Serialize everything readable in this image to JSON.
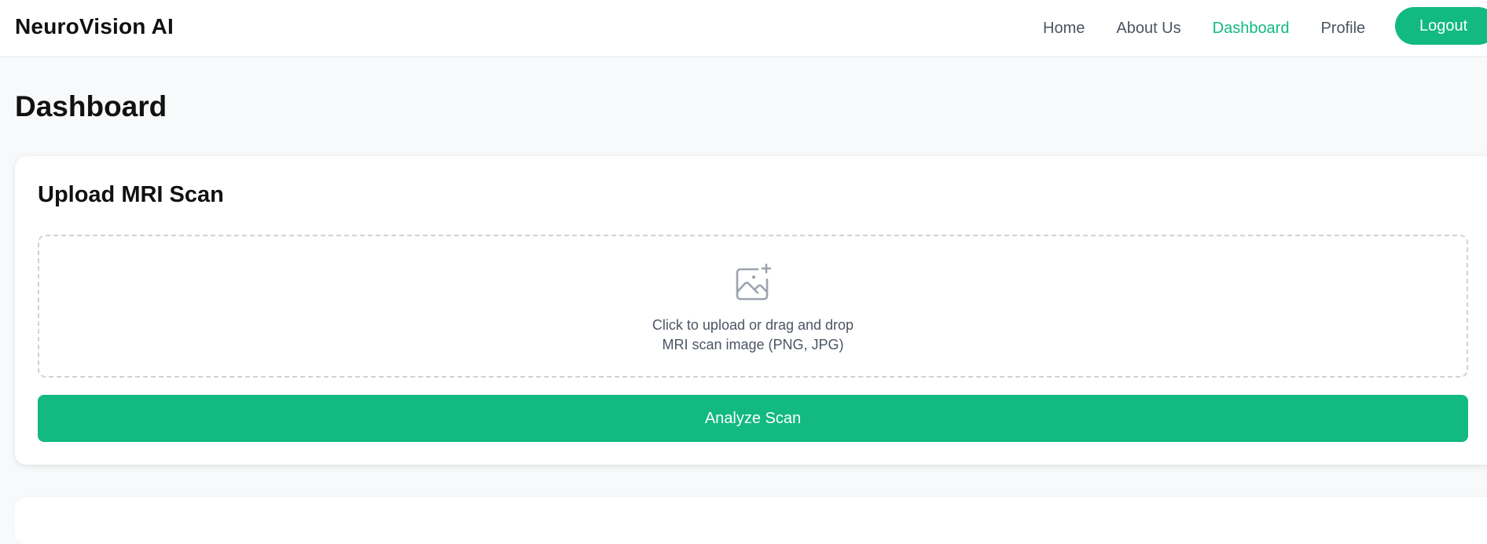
{
  "app": {
    "brand": "NeuroVision AI"
  },
  "nav": {
    "items": [
      {
        "label": "Home",
        "active": false
      },
      {
        "label": "About Us",
        "active": false
      },
      {
        "label": "Dashboard",
        "active": true
      },
      {
        "label": "Profile",
        "active": false
      }
    ],
    "logout_label": "Logout"
  },
  "page": {
    "title": "Dashboard"
  },
  "upload": {
    "title": "Upload MRI Scan",
    "icon": "image-plus-icon",
    "prompt": "Click to upload or drag and drop",
    "hint": "MRI scan image (PNG, JPG)",
    "button_label": "Analyze Scan"
  },
  "colors": {
    "accent": "#12b981",
    "background": "#f8f9fa",
    "text_muted": "#4b5563"
  }
}
